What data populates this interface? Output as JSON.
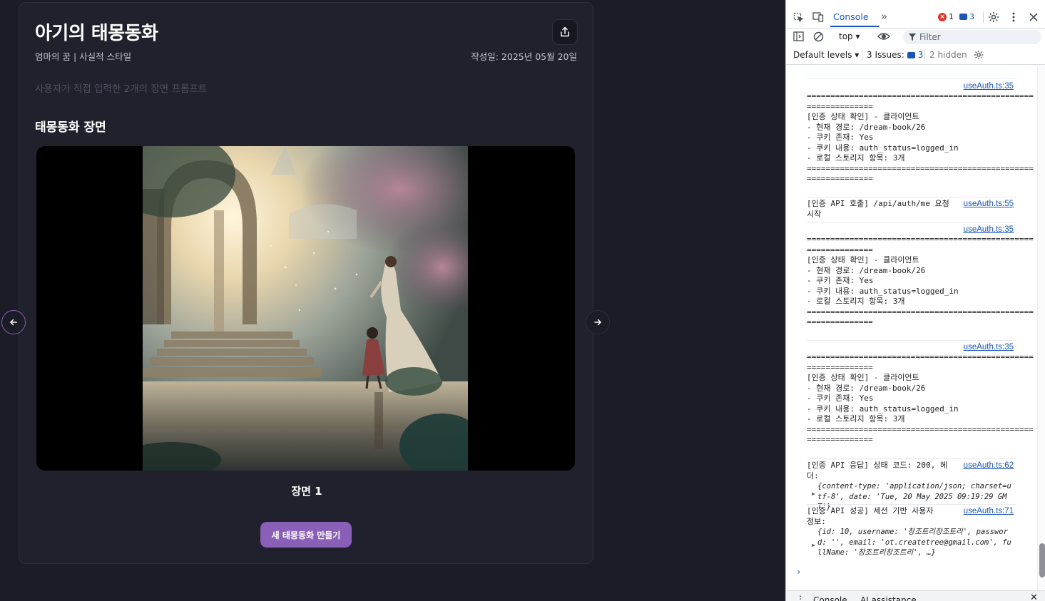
{
  "story": {
    "title": "아기의 태몽동화",
    "meta": "엄마의 꿈 | 사실적 스타일",
    "date": "작성일: 2025년 05월 20일",
    "description": "사용자가 직접 입력한 2개의 장면 프롬프트",
    "section_title": "태몽동화 장면",
    "scene_caption": "장면 1",
    "new_button": "새 태몽동화 만들기",
    "accent_color": "#8a5fb8"
  },
  "icons": {
    "share": "share-icon",
    "prev": "arrow-left-icon",
    "next": "arrow-right-icon"
  },
  "devtools": {
    "tab_console": "Console",
    "more_tabs": "»",
    "errors": "1",
    "messages": "3",
    "context": "top ▾",
    "filter_placeholder": "Filter",
    "levels": "Default levels ▾",
    "issues_label": "3 Issues:",
    "issues_count": "3",
    "hidden": "2 hidden",
    "prompt": "›",
    "bottom_console": "Console",
    "bottom_ai": "AI assistance"
  },
  "logs": [
    {
      "source": "useAuth.ts:35",
      "text": "================================================\n==============\n[인증 상태 확인] - 클라이언트\n- 현재 경로: /dream-book/26\n- 쿠키 존재: Yes\n- 쿠키 내용: auth_status=logged_in\n- 로컬 스토리지 항목: 3개\n================================================\n=============="
    },
    {
      "source": "useAuth.ts:55",
      "text": "[인증 API 호출] /api/auth/me 요청\n시작"
    },
    {
      "source": "useAuth.ts:35",
      "text": "================================================\n==============\n[인증 상태 확인] - 클라이언트\n- 현재 경로: /dream-book/26\n- 쿠키 존재: Yes\n- 쿠키 내용: auth_status=logged_in\n- 로컬 스토리지 항목: 3개\n================================================\n=============="
    },
    {
      "source": "useAuth.ts:35",
      "text": "================================================\n==============\n[인증 상태 확인] - 클라이언트\n- 현재 경로: /dream-book/26\n- 쿠키 존재: Yes\n- 쿠키 내용: auth_status=logged_in\n- 로컬 스토리지 항목: 3개\n================================================\n=============="
    },
    {
      "source": "useAuth.ts:62",
      "text": "[인증 API 응답] 상태 코드: 200, 헤\n더:"
    },
    {
      "source": "useAuth.ts:71",
      "text": "[인증 API 성공] 세션 기반 사용자\n정보:"
    }
  ],
  "headers_object": "{content-type: 'application/json; charset=utf-8', date: 'Tue, 20 May 2025 09:19:29 GMT'}",
  "user_object": "{id: 10, username: '창조트리창조트리', password: '', email: 'ot.createtree@gmail.com', fullName: '창조트리창조트리', …}"
}
